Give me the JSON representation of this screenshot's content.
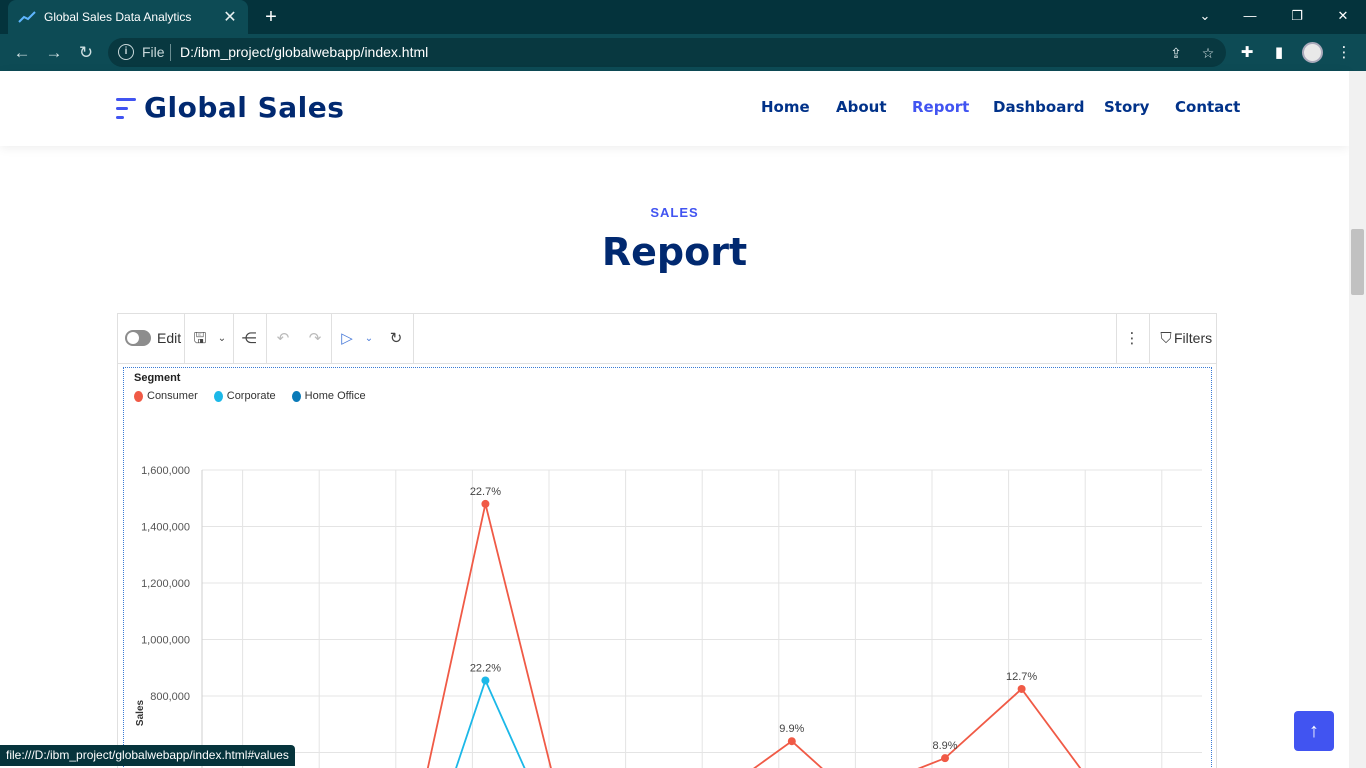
{
  "browser": {
    "tab_title": "Global Sales Data Analytics",
    "url_scheme": "File",
    "url": "D:/ibm_project/globalwebapp/index.html",
    "status_url": "file:///D:/ibm_project/globalwebapp/index.html#values"
  },
  "site": {
    "logo": "Global Sales",
    "nav": [
      "Home",
      "About",
      "Report",
      "Dashboard",
      "Story",
      "Contact"
    ],
    "active_nav": "Report"
  },
  "section": {
    "eyebrow": "SALES",
    "title": "Report"
  },
  "report_toolbar": {
    "edit_label": "Edit",
    "filters_label": "Filters"
  },
  "chart_data": {
    "type": "line",
    "legend_title": "Segment",
    "legend_position": "top-left",
    "ylabel": "Sales",
    "y_ticks": [
      "1,600,000",
      "1,400,000",
      "1,200,000",
      "1,000,000",
      "800,000"
    ],
    "series": [
      {
        "name": "Consumer",
        "color": "#f05a46",
        "points": [
          {
            "x": 3.7,
            "y": 1480000,
            "label": "22.7%"
          },
          {
            "x": 7.7,
            "y": 640000,
            "label": "9.9%"
          },
          {
            "x": 9.7,
            "y": 580000,
            "label": "8.9%"
          },
          {
            "x": 10.7,
            "y": 825000,
            "label": "12.7%"
          }
        ]
      },
      {
        "name": "Corporate",
        "color": "#1cb8e8",
        "points": [
          {
            "x": 3.7,
            "y": 855000,
            "label": "22.2%"
          }
        ]
      },
      {
        "name": "Home Office",
        "color": "#0a7ab8",
        "points": []
      }
    ]
  }
}
